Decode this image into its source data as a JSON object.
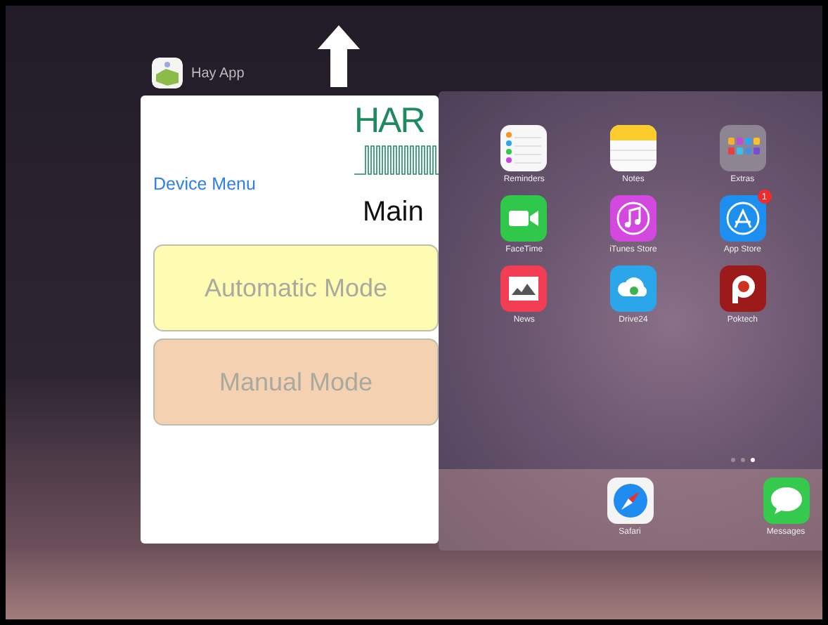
{
  "app_card": {
    "app_name": "Hay App",
    "logo_text": "HAR",
    "menu_link": "Device Menu",
    "heading": "Main",
    "buttons": [
      {
        "label": "Automatic Mode",
        "color": "#fefcb2"
      },
      {
        "label": "Manual Mode",
        "color": "#f3d1b1"
      }
    ]
  },
  "home_screen": {
    "app_rows": [
      {
        "apps": [
          {
            "label": "Reminders",
            "kind": "reminders"
          },
          {
            "label": "Notes",
            "kind": "notes"
          },
          {
            "label": "Extras",
            "kind": "folder"
          }
        ]
      },
      {
        "apps": [
          {
            "label": "FaceTime",
            "kind": "facetime"
          },
          {
            "label": "iTunes Store",
            "kind": "itunes"
          },
          {
            "label": "App Store",
            "kind": "appstore",
            "badge": "1"
          }
        ]
      },
      {
        "apps": [
          {
            "label": "News",
            "kind": "news"
          },
          {
            "label": "Drive24",
            "kind": "cloud"
          },
          {
            "label": "Poktech",
            "kind": "poktech"
          }
        ]
      }
    ],
    "page_dots": [
      {
        "selected": false
      },
      {
        "selected": false
      },
      {
        "selected": true
      }
    ],
    "dock": [
      {
        "label": "Safari",
        "kind": "safari"
      },
      {
        "label": "Messages",
        "kind": "messages"
      }
    ]
  }
}
